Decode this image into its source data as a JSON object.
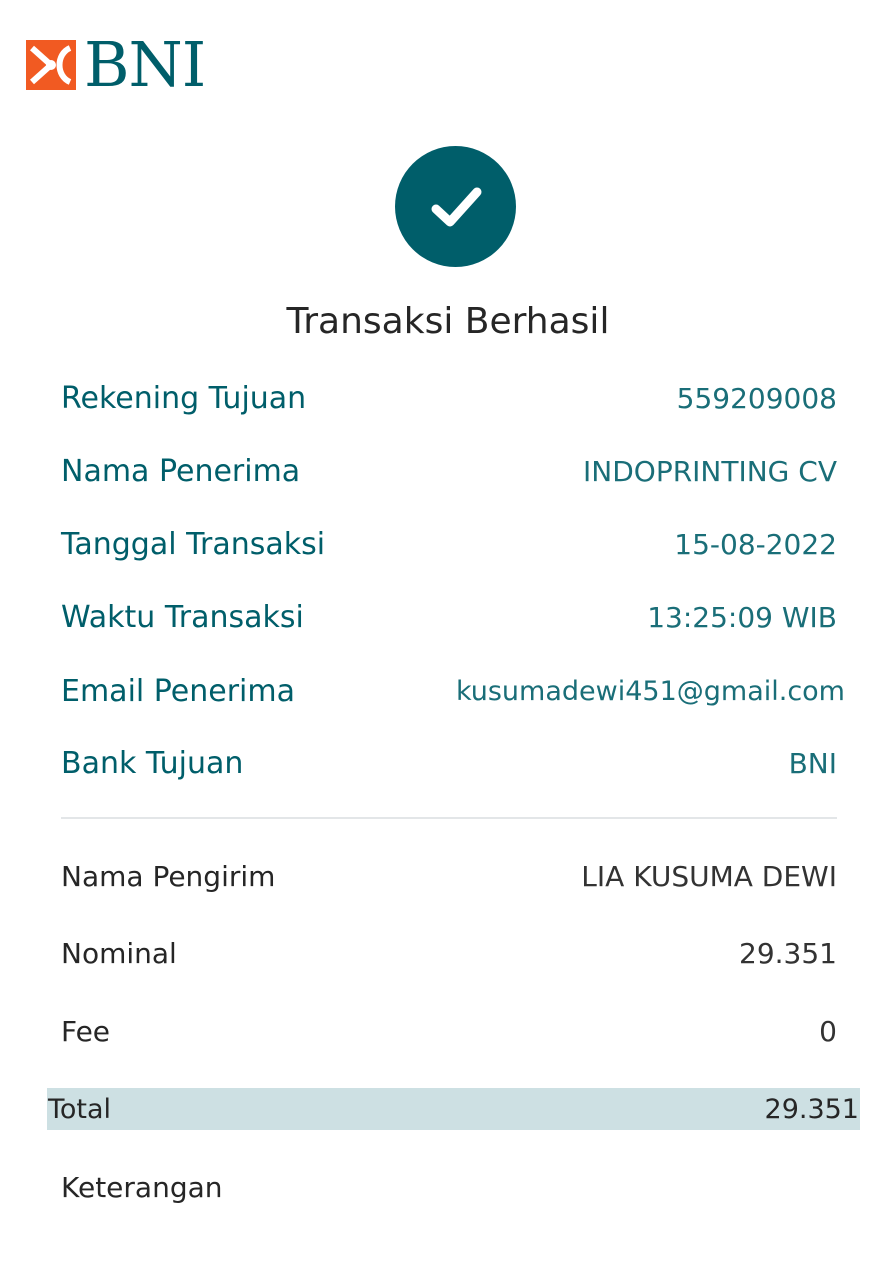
{
  "brand": {
    "name": "BNI",
    "logo_icon": "bni-logo-mark-icon",
    "accent_color": "#005e6a",
    "logo_orange": "#f15a22"
  },
  "status": {
    "icon": "check-icon",
    "title": "Transaksi Berhasil"
  },
  "recipient": [
    {
      "label": "Rekening Tujuan",
      "value": "559209008"
    },
    {
      "label": "Nama Penerima",
      "value": "INDOPRINTING CV"
    },
    {
      "label": "Tanggal Transaksi",
      "value": "15-08-2022"
    },
    {
      "label": "Waktu Transaksi",
      "value": "13:25:09 WIB"
    },
    {
      "label": "Email Penerima",
      "value": "kusumadewi451@gmail.com"
    },
    {
      "label": "Bank Tujuan",
      "value": "BNI"
    }
  ],
  "sender": [
    {
      "label": "Nama Pengirim",
      "value": "LIA KUSUMA DEWI"
    },
    {
      "label": "Nominal",
      "value": "29.351"
    },
    {
      "label": "Fee",
      "value": "0"
    }
  ],
  "total": {
    "label": "Total",
    "value": "29.351",
    "highlight_color": "#cde0e3"
  },
  "note": {
    "label": "Keterangan"
  }
}
